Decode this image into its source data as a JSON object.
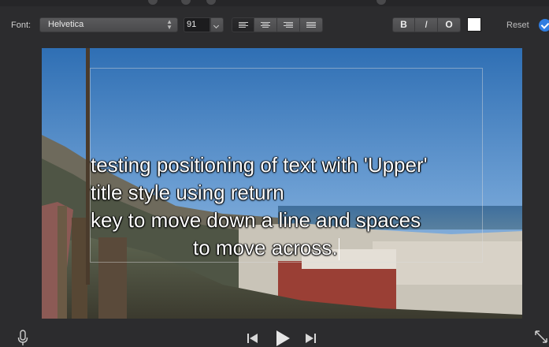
{
  "toolbar": {
    "font_label": "Font:",
    "font_value": "Helvetica",
    "size_value": "91",
    "align_buttons": [
      "align-left-icon",
      "align-center-icon",
      "align-right-icon",
      "align-justify-icon"
    ],
    "bold_label": "B",
    "italic_label": "I",
    "outline_label": "O",
    "color_value": "#ffffff",
    "reset_label": "Reset",
    "accent_color": "#2f7de1"
  },
  "viewer": {
    "title_lines": [
      "testing positioning of text with 'Upper'",
      "title style using return",
      "key to move down a line and spaces",
      "                  to move across."
    ]
  },
  "transport": {
    "icons": [
      "microphone-icon",
      "skip-back-icon",
      "play-icon",
      "skip-forward-icon",
      "fullscreen-icon"
    ]
  }
}
